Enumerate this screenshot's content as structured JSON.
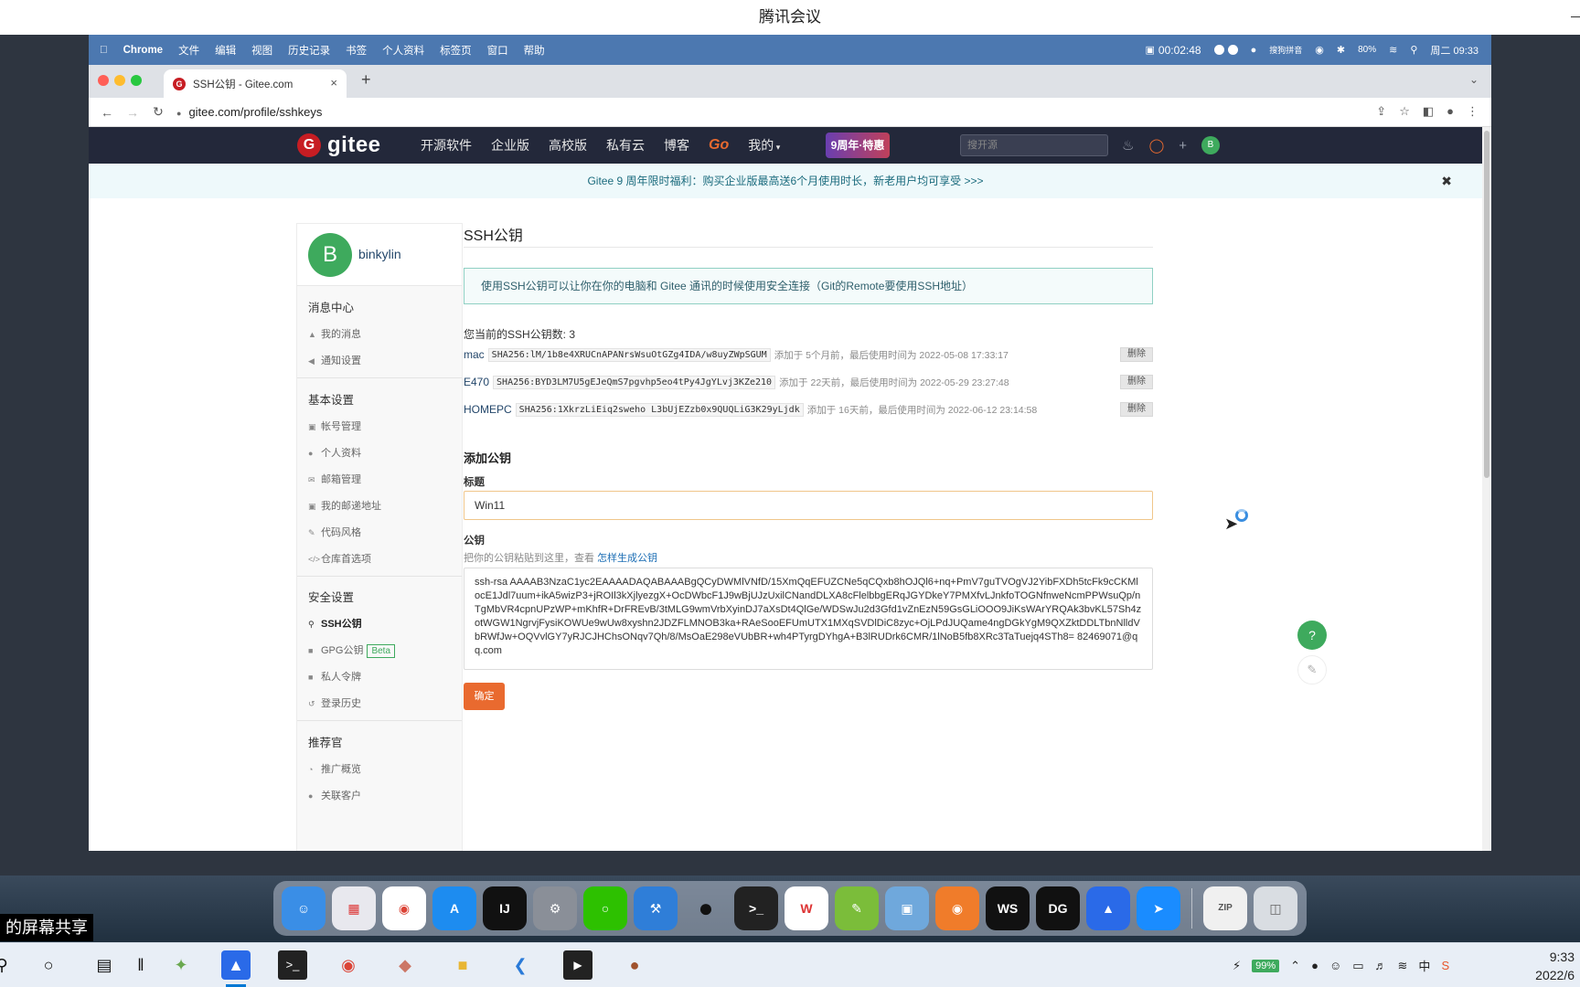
{
  "meeting": {
    "title": "腾讯会议"
  },
  "mac_menubar": {
    "apple_icon": "apple-icon",
    "items": [
      "Chrome",
      "文件",
      "编辑",
      "视图",
      "历史记录",
      "书签",
      "个人资料",
      "标签页",
      "窗口",
      "帮助"
    ],
    "recording_time": "00:02:48",
    "ime": "搜狗拼音",
    "battery": "80%",
    "datetime": "周二 09:33"
  },
  "browser": {
    "tab_title": "SSH公钥 - Gitee.com",
    "url": "gitee.com/profile/sshkeys"
  },
  "gitee": {
    "logo_text": "gitee",
    "nav": [
      "开源软件",
      "企业版",
      "高校版",
      "私有云",
      "博客",
      "Go",
      "我的"
    ],
    "badge": "9周年·特惠",
    "search_placeholder": "搜开源",
    "avatar_letter": "B",
    "notice": "Gitee 9 周年限时福利：购买企业版最高送6个月使用时长，新老用户均可享受 >>>"
  },
  "sidebar": {
    "avatar_letter": "B",
    "username": "binkylin",
    "sections": [
      {
        "title": "消息中心",
        "items": [
          "我的消息",
          "通知设置"
        ]
      },
      {
        "title": "基本设置",
        "items": [
          "帐号管理",
          "个人资料",
          "邮箱管理",
          "我的邮递地址",
          "代码风格",
          "仓库首选项"
        ]
      },
      {
        "title": "安全设置",
        "items": [
          "SSH公钥",
          "GPG公钥",
          "私人令牌",
          "登录历史"
        ]
      },
      {
        "title": "推荐官",
        "items": [
          "推广概览",
          "关联客户"
        ]
      }
    ],
    "beta_label": "Beta"
  },
  "main": {
    "title": "SSH公钥",
    "info": "使用SSH公钥可以让你在你的电脑和 Gitee 通讯的时候使用安全连接（Git的Remote要使用SSH地址）",
    "count_text": "您当前的SSH公钥数: 3",
    "keys": [
      {
        "name": "mac",
        "fingerprint": "SHA256:lM/1b8e4XRUCnAPANrsWsuOtGZg4IDA/w8uyZWpSGUM",
        "meta": "添加于 5个月前，最后使用时间为 2022-05-08 17:33:17",
        "delete": "删除"
      },
      {
        "name": "E470",
        "fingerprint": "SHA256:BYD3LM7U5gEJeQmS7pgvhp5eo4tPy4JgYLvj3KZe210",
        "meta": "添加于 22天前，最后使用时间为 2022-05-29 23:27:48",
        "delete": "删除"
      },
      {
        "name": "HOMEPC",
        "fingerprint": "SHA256:1XkrzLiEiq2sweho L3bUjEZzb0x9QUQLiG3K29yLjdk",
        "meta": "添加于 16天前，最后使用时间为 2022-06-12 23:14:58",
        "delete": "删除"
      }
    ],
    "add_title": "添加公钥",
    "label_title": "标题",
    "title_value": "Win11",
    "label_key": "公钥",
    "key_hint": "把你的公钥粘贴到这里，查看",
    "key_hint_link": "怎样生成公钥",
    "key_value": "ssh-rsa AAAAB3NzaC1yc2EAAAADAQABAAABgQCyDWMlVNfD/15XmQqEFUZCNe5qCQxb8hOJQl6+nq+PmV7guTVOgVJ2YibFXDh5tcFk9cCKMlocE1Jdl7uum+ikA5wizP3+jROIl3kXjlyezgX+OcDWbcF1J9wBjUJzUxilCNandDLXA8cFlelbbgERqJGYDkeY7PMXfvLJnkfoTOGNfnweNcmPPWsuQp/nTgMbVR4cpnUPzWP+mKhfR+DrFREvB/3tMLG9wmVrbXyinDJ7aXsDt4QlGe/WDSwJu2d3Gfd1vZnEzN59GsGLiOOO9JiKsWArYRQAk3bvKL57Sh4zotWGW1NgrvjFysiKOWUe9wUw8xyshn2JDZFLMNOB3ka+RAeSooEFUmUTX1MXqSVDlDiC8zyc+OjLPdJUQame4ngDGkYgM9QXZktDDLTbnNlldVbRWfJw+OQVvlGY7yRJCJHChsONqv7Qh/8/MsOaE298eVUbBR+wh4PTyrgDYhgA+B3lRUDrk6CMR/1lNoB5fb8XRc3TaTuejq4STh8= 82469071@qq.com",
    "submit": "确定",
    "help": "?"
  },
  "dock": {
    "apps": [
      "finder-icon",
      "launchpad-icon",
      "chrome-icon",
      "app-store-icon",
      "intellij-icon",
      "system-preferences-icon",
      "wechat-icon",
      "xcode-icon",
      "qq-icon",
      "terminal-icon",
      "wps-icon",
      "sketch-icon",
      "preview-icon",
      "tencent-meeting-icon",
      "webstorm-icon",
      "datagrip-icon",
      "lark-icon",
      "dingtalk-icon",
      "archive-icon",
      "trash-icon"
    ]
  },
  "screen_share_label": "的屏幕共享",
  "taskbar": {
    "battery": "99%",
    "ime": "中",
    "time": "9:33",
    "date": "2022/6"
  }
}
